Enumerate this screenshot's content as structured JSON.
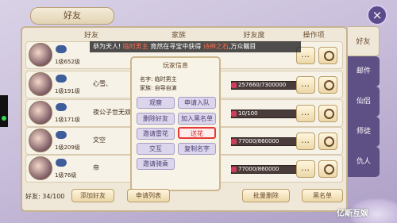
{
  "window": {
    "title": "好友",
    "close": "×"
  },
  "columns": [
    "好友",
    "家族",
    "好友度",
    "操作项"
  ],
  "banner": {
    "prefix": "恭为天人!",
    "name": "临时男主",
    "mid": "竟然在寻宝中获得",
    "item": "诗神之石",
    "suffix": ",万众瞩目"
  },
  "friends": [
    {
      "level": "1级652级",
      "name": "",
      "family": "",
      "friendship": ""
    },
    {
      "level": "1级191级",
      "name": "心雪、",
      "family": "",
      "friendship": "257660/7300000"
    },
    {
      "level": "1级171级",
      "name": "夜公子世无双",
      "family": "",
      "friendship": "10/100"
    },
    {
      "level": "1级209级",
      "name": "文空",
      "family": "",
      "friendship": "77000/860000"
    },
    {
      "level": "1级76级",
      "name": "帝",
      "family": "",
      "friendship": "77000/860000"
    }
  ],
  "popup": {
    "title": "玩家信息",
    "info_name": "名字: 临时男主",
    "info_family": "家族: 自导自演",
    "buttons": [
      "观察",
      "申请入队",
      "删除好友",
      "加入黑名单",
      "邀请雷花",
      "送花",
      "交互",
      "复制名字",
      "邀请骑乘"
    ]
  },
  "side_tabs": [
    "好友",
    "邮件",
    "仙侣",
    "师徒",
    "仇人"
  ],
  "footer": {
    "count_label": "好友: 34/100",
    "add": "添加好友",
    "requests": "申请列表",
    "batch_delete": "批量删除",
    "blacklist": "黑名单"
  },
  "watermark": "亿斯互娱"
}
